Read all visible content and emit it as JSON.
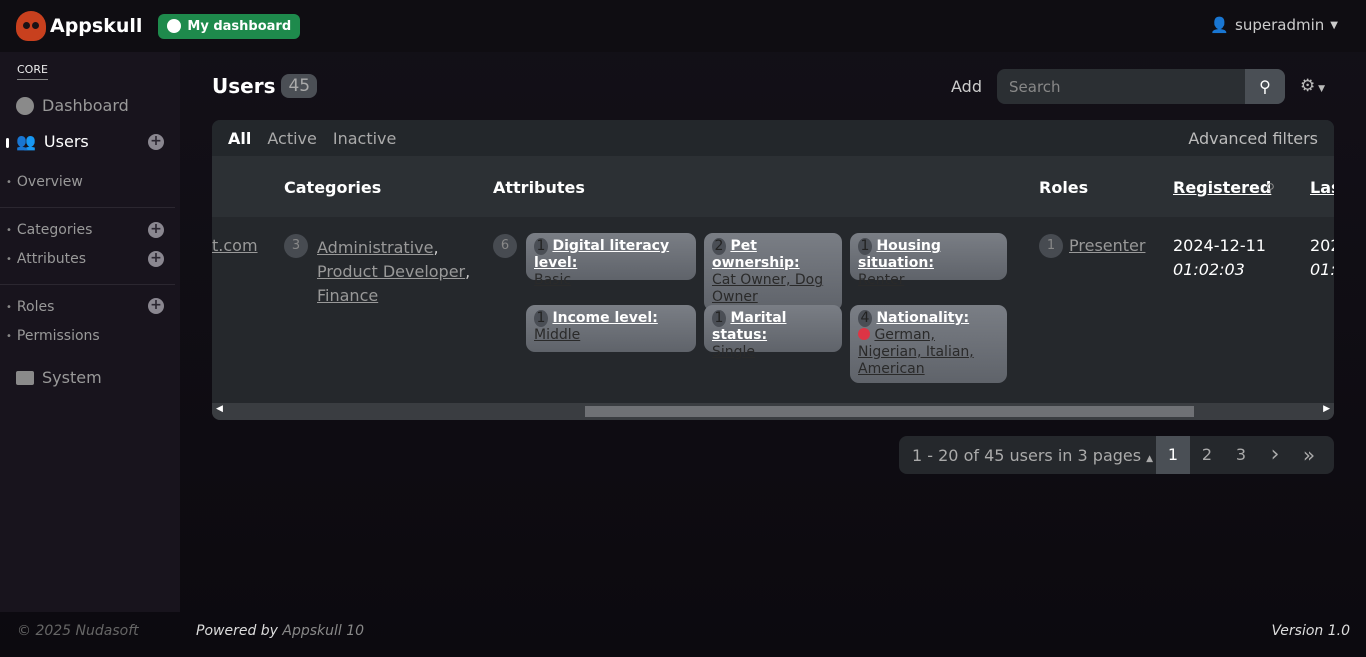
{
  "app": {
    "name": "Appskull",
    "dashboard_button": "My dashboard",
    "user": "superadmin"
  },
  "sidebar": {
    "section": "CORE",
    "dashboard": "Dashboard",
    "users": "Users",
    "overview": "Overview",
    "categories": "Categories",
    "attributes": "Attributes",
    "roles": "Roles",
    "permissions": "Permissions",
    "system": "System"
  },
  "page": {
    "title": "Users",
    "count": "45",
    "add": "Add",
    "search_placeholder": "Search"
  },
  "filters": {
    "all": "All",
    "active": "Active",
    "inactive": "Inactive",
    "advanced": "Advanced filters"
  },
  "table": {
    "headers": {
      "categories": "Categories",
      "attributes": "Attributes",
      "roles": "Roles",
      "registered": "Registered",
      "last": "Las"
    },
    "row": {
      "email_fragment": "t.com",
      "categories_count": "3",
      "categories": [
        "Administrative",
        "Product Developer",
        "Finance"
      ],
      "attributes_count": "6",
      "attributes": [
        {
          "count": "1",
          "name": "Digital literacy level:",
          "values": "Basic"
        },
        {
          "count": "2",
          "name": "Pet ownership:",
          "values": "Cat Owner, Dog Owner"
        },
        {
          "count": "1",
          "name": "Housing situation:",
          "values": "Renter"
        },
        {
          "count": "1",
          "name": "Income level:",
          "values": "Middle"
        },
        {
          "count": "1",
          "name": "Marital status:",
          "values": "Single"
        },
        {
          "count": "4",
          "name": "Nationality:",
          "values": "German, Nigerian, Italian, American"
        }
      ],
      "roles_count": "1",
      "role": "Presenter",
      "registered_date": "2024-12-11",
      "registered_time": "01:02:03",
      "last_date_fragment": "202",
      "last_time_fragment": "01:0"
    }
  },
  "pagination": {
    "info": "1 - 20 of 45 users in 3 pages",
    "pages": [
      "1",
      "2",
      "3"
    ],
    "current": "1",
    "next": "›",
    "last": "»"
  },
  "footer": {
    "copyright": "© 2025 Nudasoft",
    "powered_by": "Powered by",
    "product": "Appskull 10",
    "version": "Version 1.0"
  },
  "colors": {
    "brand": "#c8401e",
    "dashboard_button": "#1e8a4c",
    "badge_red": "#dc3545"
  }
}
